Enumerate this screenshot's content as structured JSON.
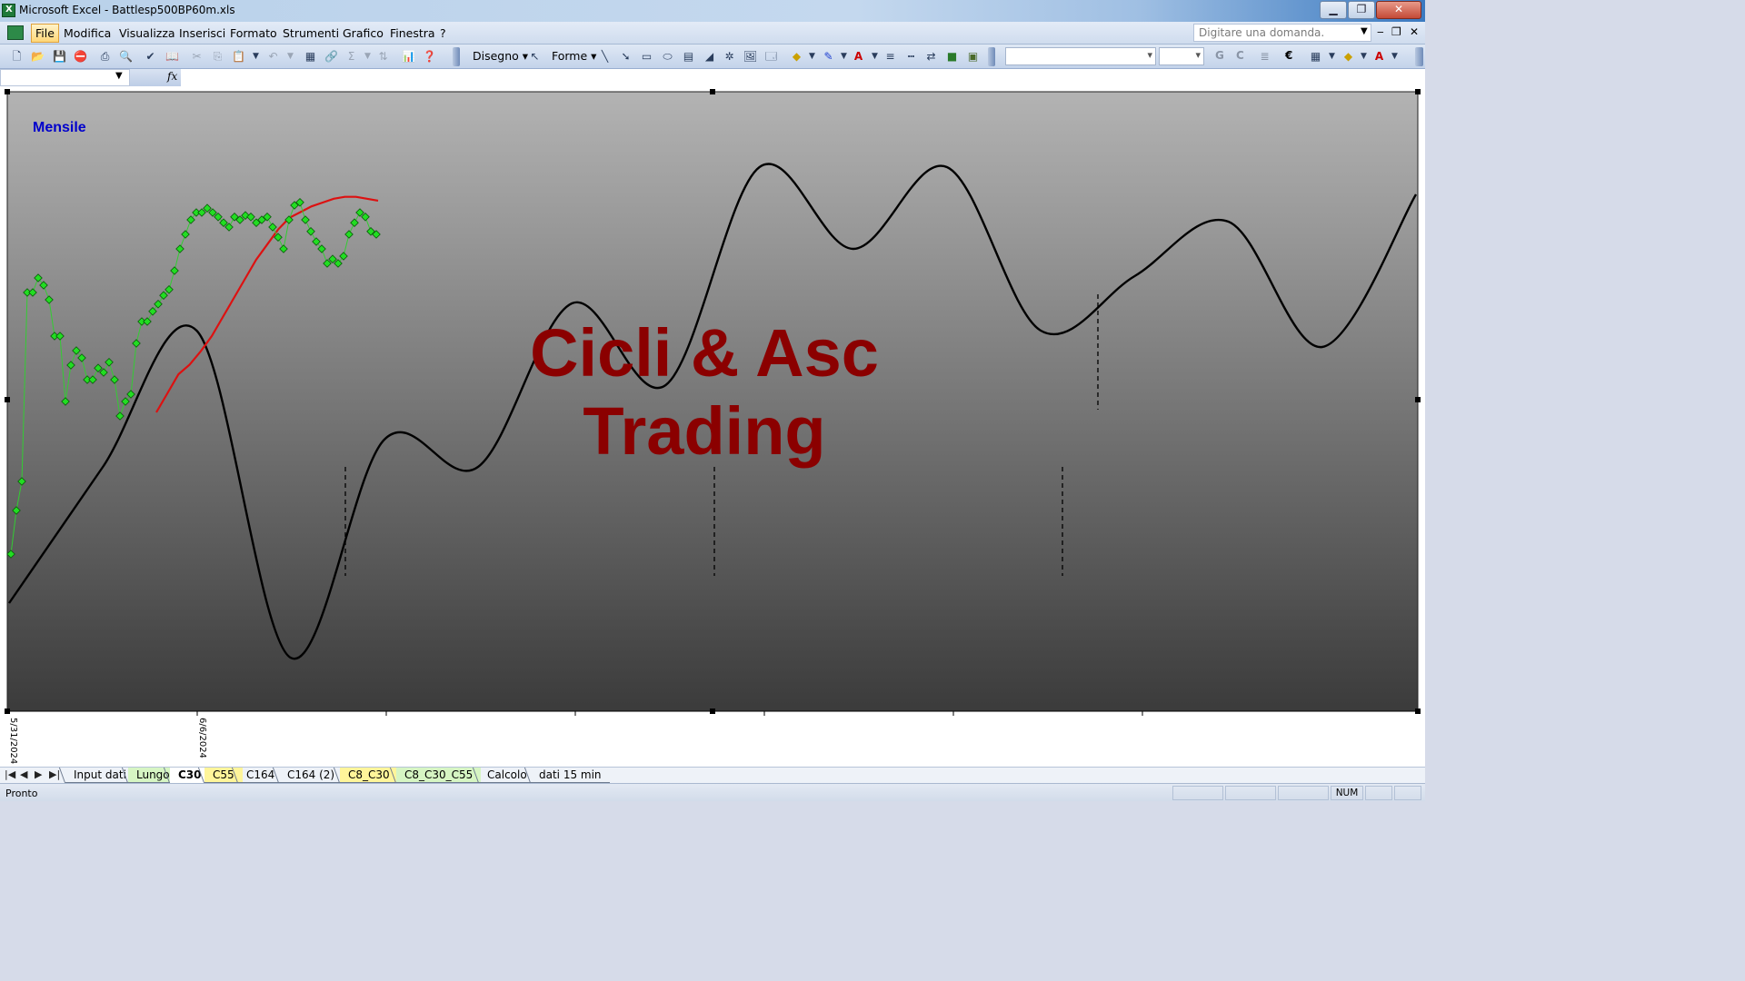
{
  "window": {
    "title": "Microsoft Excel - Battlesp500BP60m.xls",
    "controls": {
      "minimize": "▁",
      "restore": "❐",
      "close": "✕"
    }
  },
  "menubar": {
    "items": [
      "File",
      "Modifica",
      "Visualizza",
      "Inserisci",
      "Formato",
      "Strumenti",
      "Grafico",
      "Finestra",
      "?"
    ],
    "ask_placeholder": "Digitare una domanda.",
    "mdi": {
      "minimize": "‒",
      "restore": "❐",
      "close": "✕"
    }
  },
  "toolbar": {
    "disegno": "Disegno",
    "forme": "Forme",
    "bold": "G",
    "italic": "C",
    "euro": "€"
  },
  "formula_bar": {
    "name_box": "",
    "fx": "fx",
    "content": ""
  },
  "chart": {
    "label_period": "Mensile",
    "watermark_line1": "Cicli & Asc",
    "watermark_line2": "Trading",
    "date_labels": [
      "5/31/2024",
      "6/6/2024"
    ],
    "colors": {
      "plot_top": "#b3b3b3",
      "plot_bottom": "#3b3b3b",
      "price_marker": "#22dd22",
      "price_line": "#33cc33",
      "average": "#dd1111",
      "cycle": "#000000",
      "watermark": "#8b0000",
      "label": "#0000cc"
    }
  },
  "chart_data": {
    "type": "line",
    "title": "",
    "x_labels": [
      "5/31/2024",
      "6/6/2024"
    ],
    "series": [
      {
        "name": "",
        "kind": "scatter-line",
        "color": "#22dd22",
        "values": [
          2.9,
          2.6,
          2.4,
          1.1,
          1.1,
          1.0,
          1.05,
          1.15,
          1.4,
          1.4,
          1.85,
          1.6,
          1.5,
          1.55,
          1.7,
          1.7,
          1.62,
          1.65,
          1.58,
          1.7,
          1.95,
          1.85,
          1.8,
          1.45,
          1.3,
          1.3,
          1.23,
          1.18,
          1.12,
          1.08,
          0.95,
          0.8,
          0.7,
          0.6,
          0.55,
          0.55,
          0.52,
          0.55,
          0.58,
          0.62,
          0.65,
          0.58,
          0.6,
          0.57,
          0.58,
          0.62,
          0.6,
          0.58,
          0.65,
          0.72,
          0.8,
          0.6,
          0.5,
          0.48,
          0.6,
          0.68,
          0.75,
          0.8,
          0.9,
          0.87,
          0.9,
          0.85,
          0.7,
          0.62,
          0.55,
          0.58,
          0.68,
          0.7
        ]
      },
      {
        "name": "",
        "kind": "line",
        "color": "#dd1111",
        "values": [
          1.8,
          1.7,
          1.6,
          1.55,
          1.48,
          1.4,
          1.3,
          1.2,
          1.1,
          1.0,
          0.92,
          0.84,
          0.78,
          0.75,
          0.72,
          0.7,
          0.68,
          0.67,
          0.67,
          0.68,
          0.69
        ]
      },
      {
        "name": "",
        "kind": "cycle",
        "color": "#000000",
        "values": [
          0.85,
          0.6,
          0.35,
          0.95,
          0.55,
          0.6,
          0.3,
          0.45,
          0.05,
          0.2,
          0.05,
          0.35,
          0.25,
          0.15,
          0.38,
          0.1
        ]
      }
    ]
  },
  "sheet_tabs": [
    "Input dati",
    "Lungo",
    "C30",
    "C55",
    "C164",
    "C164 (2)",
    "C8_C30",
    "C8_C30_C55",
    "Calcolo",
    "dati 15 min"
  ],
  "active_sheet": "C30",
  "tab_colors": {
    "Lungo": "#d6f5c3",
    "C55": "#fff59a",
    "C8_C30": "#fff59a",
    "C8_C30_C55": "#d6f5c3"
  },
  "statusbar": {
    "status": "Pronto",
    "num": "NUM"
  }
}
